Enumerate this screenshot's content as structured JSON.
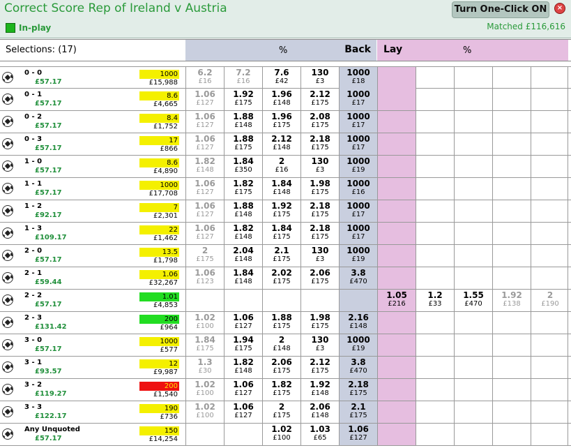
{
  "header": {
    "title": "Correct Score Rep of Ireland v Austria",
    "inplay_label": "In-play",
    "oneclick_label": "Turn One-Click ON",
    "close_glyph": "×",
    "matched_label": "Matched",
    "matched_value": "£116,616"
  },
  "columns": {
    "selections_label": "Selections: (17)",
    "back_pct": "%",
    "back_label": "Back",
    "lay_label": "Lay",
    "lay_pct": "%"
  },
  "colors": {
    "accent_green": "#2a9a3a",
    "back_best": "#c9cfdf",
    "lay_best": "#e6bee0",
    "ltp_yellow": "#f4f000",
    "ltp_green": "#22dd22",
    "ltp_red": "#ee1111"
  },
  "rows": [
    {
      "name": "0 - 0",
      "pl": "£57.17",
      "ltp": "1000",
      "ltp_color": "yellow",
      "vol": "£15,988",
      "back": [
        {
          "p": "6.2",
          "s": "£16",
          "dim": true
        },
        {
          "p": "7.2",
          "s": "£16",
          "dim": true
        },
        {
          "p": "7.6",
          "s": "£42",
          "dim": false
        },
        {
          "p": "130",
          "s": "£3",
          "dim": false
        },
        {
          "p": "1000",
          "s": "£18",
          "dim": false
        }
      ],
      "lay": []
    },
    {
      "name": "0 - 1",
      "pl": "£57.17",
      "ltp": "8.6",
      "ltp_color": "yellow",
      "vol": "£4,665",
      "back": [
        {
          "p": "1.06",
          "s": "£127",
          "dim": true
        },
        {
          "p": "1.92",
          "s": "£175",
          "dim": false
        },
        {
          "p": "1.96",
          "s": "£148",
          "dim": false
        },
        {
          "p": "2.12",
          "s": "£175",
          "dim": false
        },
        {
          "p": "1000",
          "s": "£17",
          "dim": false
        }
      ],
      "lay": []
    },
    {
      "name": "0 - 2",
      "pl": "£57.17",
      "ltp": "8.4",
      "ltp_color": "yellow",
      "vol": "£1,752",
      "back": [
        {
          "p": "1.06",
          "s": "£127",
          "dim": true
        },
        {
          "p": "1.88",
          "s": "£148",
          "dim": false
        },
        {
          "p": "1.96",
          "s": "£175",
          "dim": false
        },
        {
          "p": "2.08",
          "s": "£175",
          "dim": false
        },
        {
          "p": "1000",
          "s": "£17",
          "dim": false
        }
      ],
      "lay": []
    },
    {
      "name": "0 - 3",
      "pl": "£57.17",
      "ltp": "17",
      "ltp_color": "yellow",
      "vol": "£866",
      "back": [
        {
          "p": "1.06",
          "s": "£127",
          "dim": true
        },
        {
          "p": "1.88",
          "s": "£175",
          "dim": false
        },
        {
          "p": "2.12",
          "s": "£148",
          "dim": false
        },
        {
          "p": "2.18",
          "s": "£175",
          "dim": false
        },
        {
          "p": "1000",
          "s": "£17",
          "dim": false
        }
      ],
      "lay": []
    },
    {
      "name": "1 - 0",
      "pl": "£57.17",
      "ltp": "8.6",
      "ltp_color": "yellow",
      "vol": "£4,890",
      "back": [
        {
          "p": "1.82",
          "s": "£148",
          "dim": true
        },
        {
          "p": "1.84",
          "s": "£350",
          "dim": false
        },
        {
          "p": "2",
          "s": "£16",
          "dim": false
        },
        {
          "p": "130",
          "s": "£3",
          "dim": false
        },
        {
          "p": "1000",
          "s": "£19",
          "dim": false
        }
      ],
      "lay": []
    },
    {
      "name": "1 - 1",
      "pl": "£57.17",
      "ltp": "1000",
      "ltp_color": "yellow",
      "vol": "£17,708",
      "back": [
        {
          "p": "1.06",
          "s": "£127",
          "dim": true
        },
        {
          "p": "1.82",
          "s": "£175",
          "dim": false
        },
        {
          "p": "1.84",
          "s": "£148",
          "dim": false
        },
        {
          "p": "1.98",
          "s": "£175",
          "dim": false
        },
        {
          "p": "1000",
          "s": "£16",
          "dim": false
        }
      ],
      "lay": []
    },
    {
      "name": "1 - 2",
      "pl": "£92.17",
      "ltp": "7",
      "ltp_color": "yellow",
      "vol": "£2,301",
      "back": [
        {
          "p": "1.06",
          "s": "£127",
          "dim": true
        },
        {
          "p": "1.88",
          "s": "£148",
          "dim": false
        },
        {
          "p": "1.92",
          "s": "£175",
          "dim": false
        },
        {
          "p": "2.18",
          "s": "£175",
          "dim": false
        },
        {
          "p": "1000",
          "s": "£17",
          "dim": false
        }
      ],
      "lay": []
    },
    {
      "name": "1 - 3",
      "pl": "£109.17",
      "ltp": "22",
      "ltp_color": "yellow",
      "vol": "£1,462",
      "back": [
        {
          "p": "1.06",
          "s": "£127",
          "dim": true
        },
        {
          "p": "1.82",
          "s": "£148",
          "dim": false
        },
        {
          "p": "1.84",
          "s": "£175",
          "dim": false
        },
        {
          "p": "2.18",
          "s": "£175",
          "dim": false
        },
        {
          "p": "1000",
          "s": "£17",
          "dim": false
        }
      ],
      "lay": []
    },
    {
      "name": "2 - 0",
      "pl": "£57.17",
      "ltp": "13.5",
      "ltp_color": "yellow",
      "vol": "£1,798",
      "back": [
        {
          "p": "2",
          "s": "£175",
          "dim": true
        },
        {
          "p": "2.04",
          "s": "£148",
          "dim": false
        },
        {
          "p": "2.1",
          "s": "£175",
          "dim": false
        },
        {
          "p": "130",
          "s": "£3",
          "dim": false
        },
        {
          "p": "1000",
          "s": "£19",
          "dim": false
        }
      ],
      "lay": []
    },
    {
      "name": "2 - 1",
      "pl": "£59.44",
      "ltp": "1.06",
      "ltp_color": "yellow",
      "vol": "£32,267",
      "back": [
        {
          "p": "1.06",
          "s": "£123",
          "dim": true
        },
        {
          "p": "1.84",
          "s": "£148",
          "dim": false
        },
        {
          "p": "2.02",
          "s": "£175",
          "dim": false
        },
        {
          "p": "2.06",
          "s": "£175",
          "dim": false
        },
        {
          "p": "3.8",
          "s": "£470",
          "dim": false
        }
      ],
      "lay": []
    },
    {
      "name": "2 - 2",
      "pl": "£57.17",
      "ltp": "1.01",
      "ltp_color": "green",
      "vol": "£4,853",
      "back": [
        {
          "p": "",
          "s": "",
          "dim": false
        },
        {
          "p": "",
          "s": "",
          "dim": false
        },
        {
          "p": "",
          "s": "",
          "dim": false
        },
        {
          "p": "",
          "s": "",
          "dim": false
        },
        {
          "p": "",
          "s": "",
          "dim": false
        }
      ],
      "lay": [
        {
          "p": "1.05",
          "s": "£216",
          "dim": false
        },
        {
          "p": "1.2",
          "s": "£33",
          "dim": false
        },
        {
          "p": "1.55",
          "s": "£470",
          "dim": false
        },
        {
          "p": "1.92",
          "s": "£138",
          "dim": true
        },
        {
          "p": "2",
          "s": "£190",
          "dim": true
        }
      ]
    },
    {
      "name": "2 - 3",
      "pl": "£131.42",
      "ltp": "200",
      "ltp_color": "green",
      "vol": "£964",
      "back": [
        {
          "p": "1.02",
          "s": "£100",
          "dim": true
        },
        {
          "p": "1.06",
          "s": "£127",
          "dim": false
        },
        {
          "p": "1.88",
          "s": "£175",
          "dim": false
        },
        {
          "p": "1.98",
          "s": "£175",
          "dim": false
        },
        {
          "p": "2.16",
          "s": "£148",
          "dim": false
        }
      ],
      "lay": []
    },
    {
      "name": "3 - 0",
      "pl": "£57.17",
      "ltp": "1000",
      "ltp_color": "yellow",
      "vol": "£577",
      "back": [
        {
          "p": "1.84",
          "s": "£175",
          "dim": true
        },
        {
          "p": "1.94",
          "s": "£175",
          "dim": false
        },
        {
          "p": "2",
          "s": "£148",
          "dim": false
        },
        {
          "p": "130",
          "s": "£3",
          "dim": false
        },
        {
          "p": "1000",
          "s": "£19",
          "dim": false
        }
      ],
      "lay": []
    },
    {
      "name": "3 - 1",
      "pl": "£93.57",
      "ltp": "12",
      "ltp_color": "yellow",
      "vol": "£9,987",
      "back": [
        {
          "p": "1.3",
          "s": "£30",
          "dim": true
        },
        {
          "p": "1.82",
          "s": "£148",
          "dim": false
        },
        {
          "p": "2.06",
          "s": "£175",
          "dim": false
        },
        {
          "p": "2.12",
          "s": "£175",
          "dim": false
        },
        {
          "p": "3.8",
          "s": "£470",
          "dim": false
        }
      ],
      "lay": []
    },
    {
      "name": "3 - 2",
      "pl": "£119.27",
      "ltp": "200",
      "ltp_color": "red",
      "vol": "£1,540",
      "back": [
        {
          "p": "1.02",
          "s": "£100",
          "dim": true
        },
        {
          "p": "1.06",
          "s": "£127",
          "dim": false
        },
        {
          "p": "1.82",
          "s": "£175",
          "dim": false
        },
        {
          "p": "1.92",
          "s": "£148",
          "dim": false
        },
        {
          "p": "2.18",
          "s": "£175",
          "dim": false
        }
      ],
      "lay": []
    },
    {
      "name": "3 - 3",
      "pl": "£122.17",
      "ltp": "190",
      "ltp_color": "yellow",
      "vol": "£736",
      "back": [
        {
          "p": "1.02",
          "s": "£100",
          "dim": true
        },
        {
          "p": "1.06",
          "s": "£127",
          "dim": false
        },
        {
          "p": "2",
          "s": "£175",
          "dim": false
        },
        {
          "p": "2.06",
          "s": "£148",
          "dim": false
        },
        {
          "p": "2.1",
          "s": "£175",
          "dim": false
        }
      ],
      "lay": []
    },
    {
      "name": "Any Unquoted",
      "pl": "£57.17",
      "ltp": "150",
      "ltp_color": "yellow",
      "vol": "£14,254",
      "back": [
        {
          "p": "",
          "s": "",
          "dim": false
        },
        {
          "p": "",
          "s": "",
          "dim": false
        },
        {
          "p": "1.02",
          "s": "£100",
          "dim": false
        },
        {
          "p": "1.03",
          "s": "£65",
          "dim": false
        },
        {
          "p": "1.06",
          "s": "£127",
          "dim": false
        }
      ],
      "lay": []
    }
  ]
}
